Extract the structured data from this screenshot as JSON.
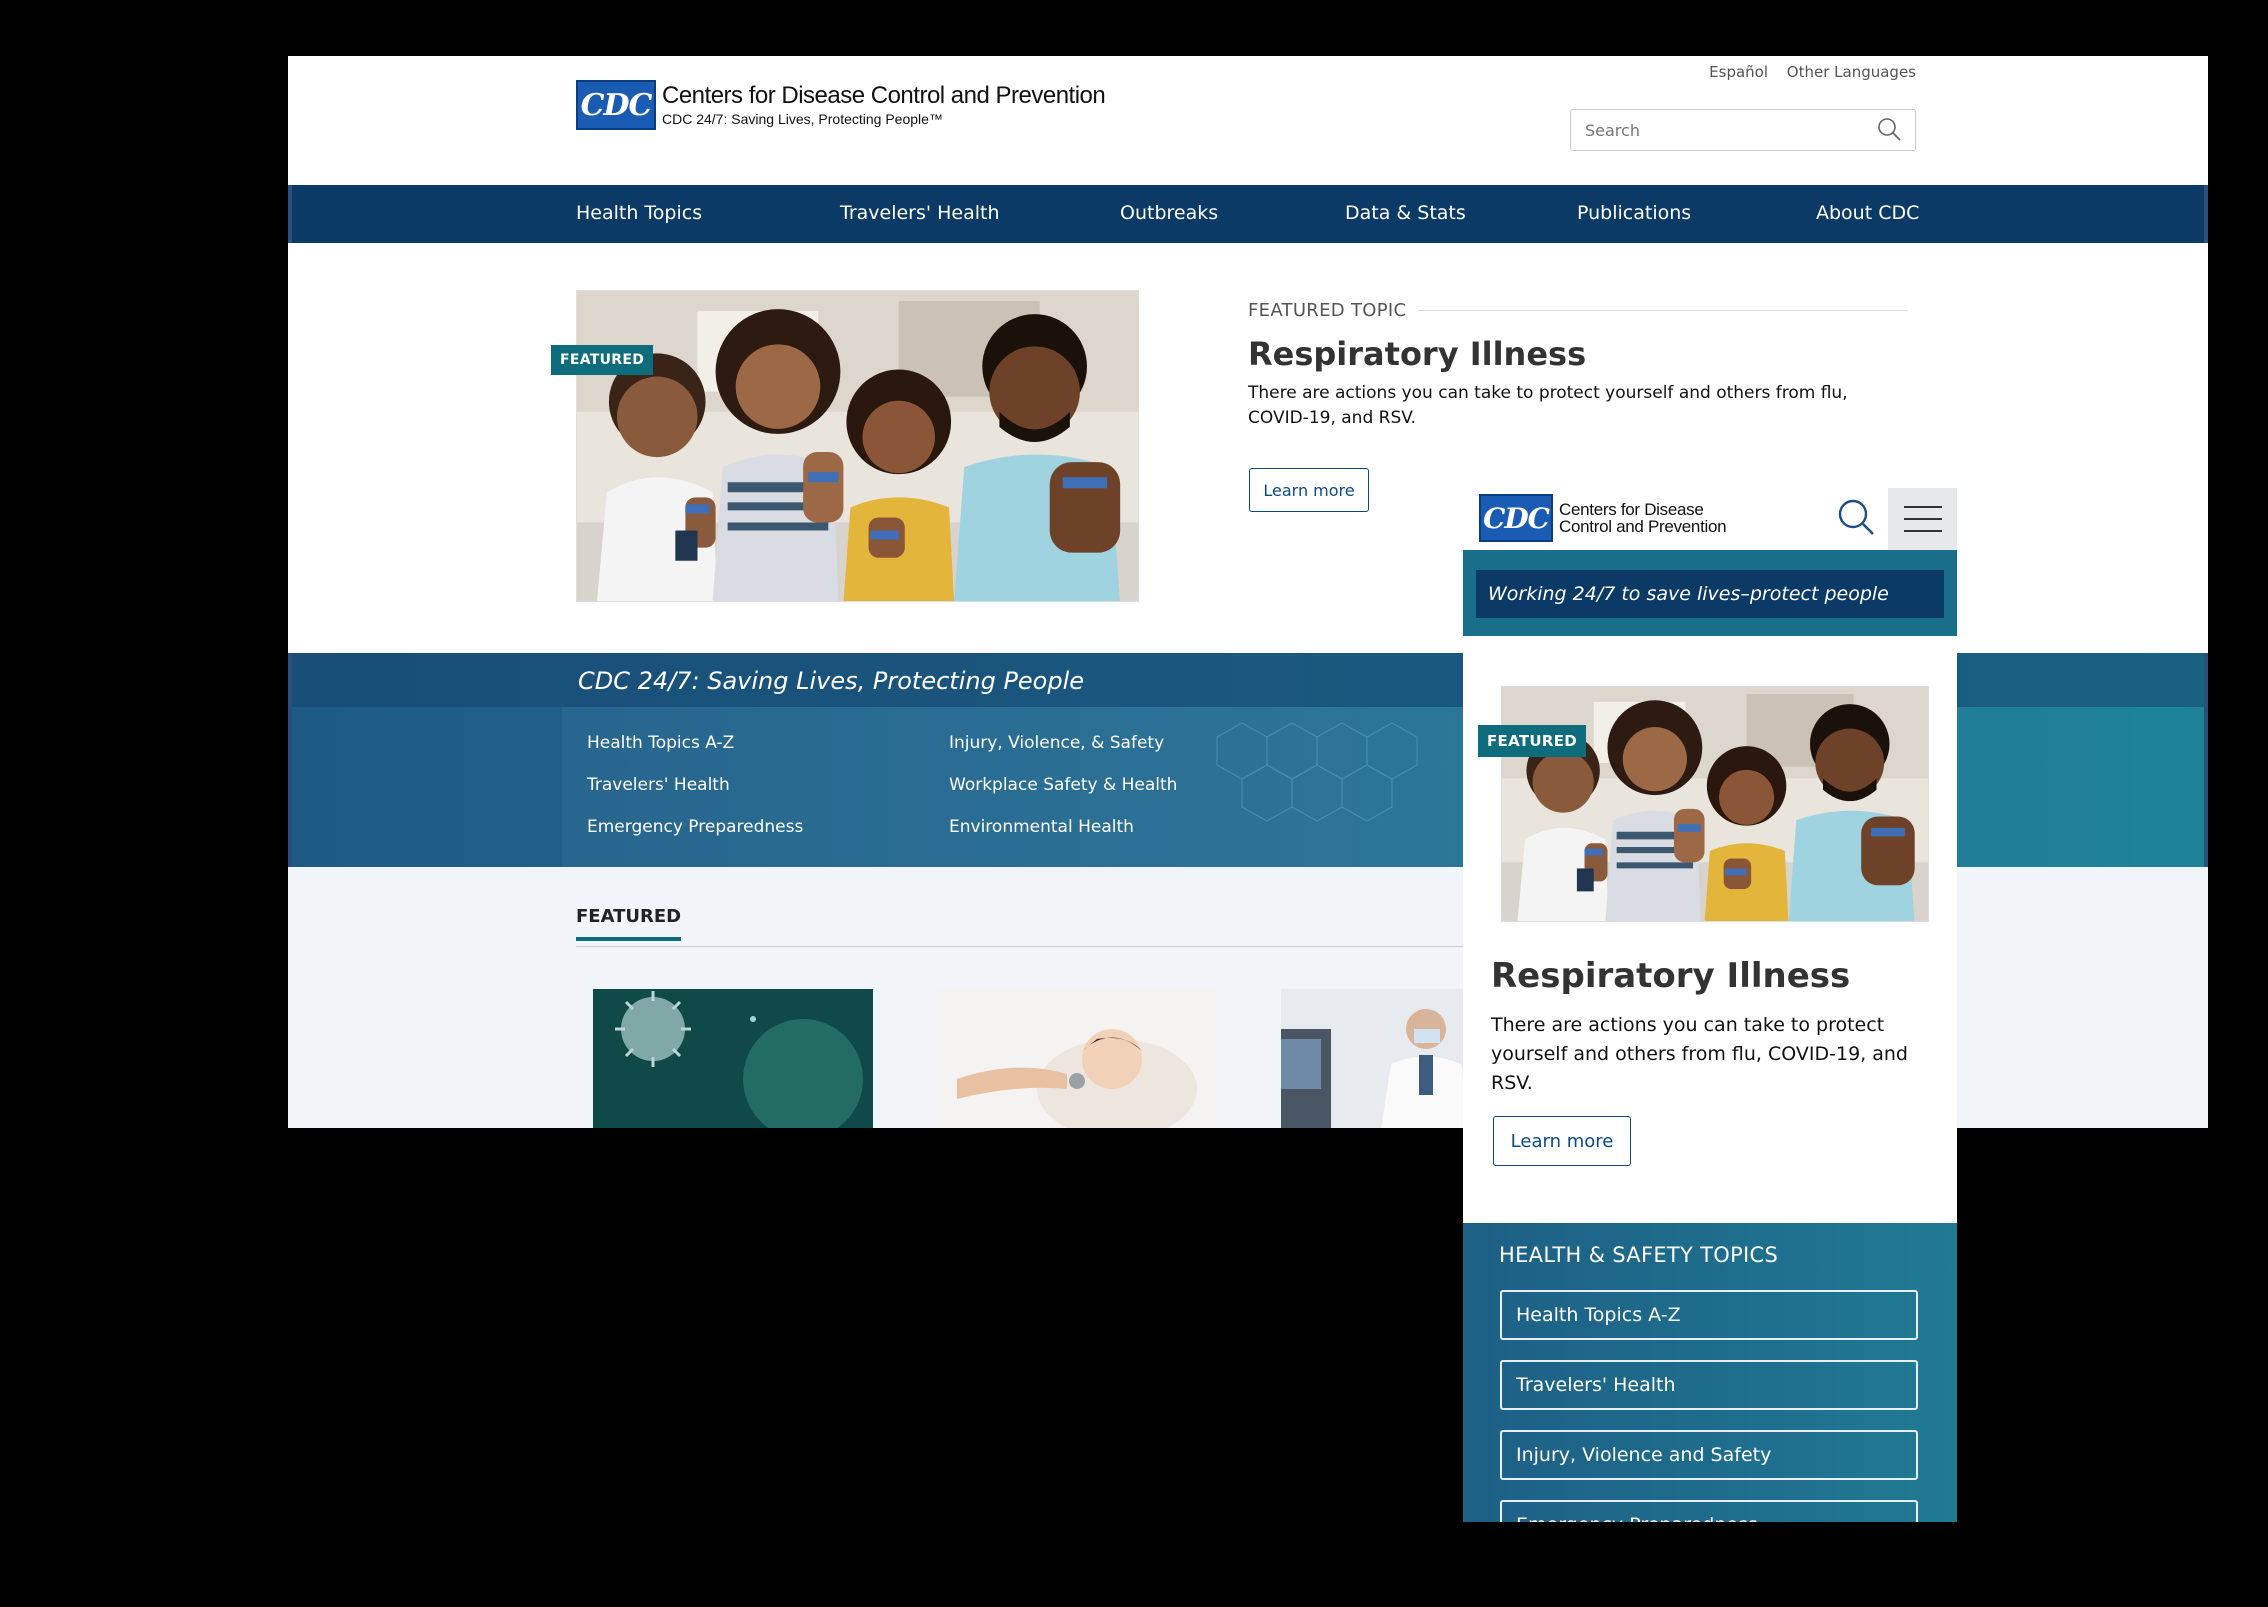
{
  "desktop": {
    "org_name": "Centers for Disease Control and Prevention",
    "logo_text": "CDC",
    "tagline_small": "CDC 24/7: Saving Lives, Protecting People™",
    "lang_links": [
      "Español",
      "Other Languages"
    ],
    "search_placeholder": "Search",
    "nav": [
      "Health Topics",
      "Travelers' Health",
      "Outbreaks",
      "Data & Stats",
      "Publications",
      "About CDC"
    ],
    "featured_badge": "FEATURED",
    "featured_topic": {
      "eyebrow": "FEATURED TOPIC",
      "title": "Respiratory Illness",
      "desc": "There are actions you can take to protect yourself and others from flu, COVID-19, and RSV.",
      "button": "Learn more"
    },
    "band": {
      "tagline": "CDC 24/7: Saving Lives, Protecting People",
      "links": [
        "Health Topics A-Z",
        "Travelers' Health",
        "Emergency Preparedness",
        "Injury, Violence, & Safety",
        "Workplace Safety & Health",
        "Environmental Health"
      ]
    },
    "featured_section_title": "FEATURED"
  },
  "mobile": {
    "logo_text": "CDC",
    "org_name_line1": "Centers for Disease",
    "org_name_line2": "Control and Prevention",
    "tagline": "Working 24/7 to save lives–protect people",
    "featured_badge": "FEATURED",
    "title": "Respiratory Illness",
    "desc": "There are actions you can take to protect yourself and others from flu, COVID-19, and RSV.",
    "button": "Learn more",
    "topics_heading": "HEALTH & SAFETY TOPICS",
    "topics": [
      "Health Topics A-Z",
      "Travelers' Health",
      "Injury, Violence and Safety",
      "Emergency Preparedness"
    ]
  },
  "colors": {
    "nav_blue": "#0b3a67",
    "teal": "#0e6d7c",
    "link_blue": "#0b4a87",
    "cdc_logo": "#1a5cb3"
  }
}
